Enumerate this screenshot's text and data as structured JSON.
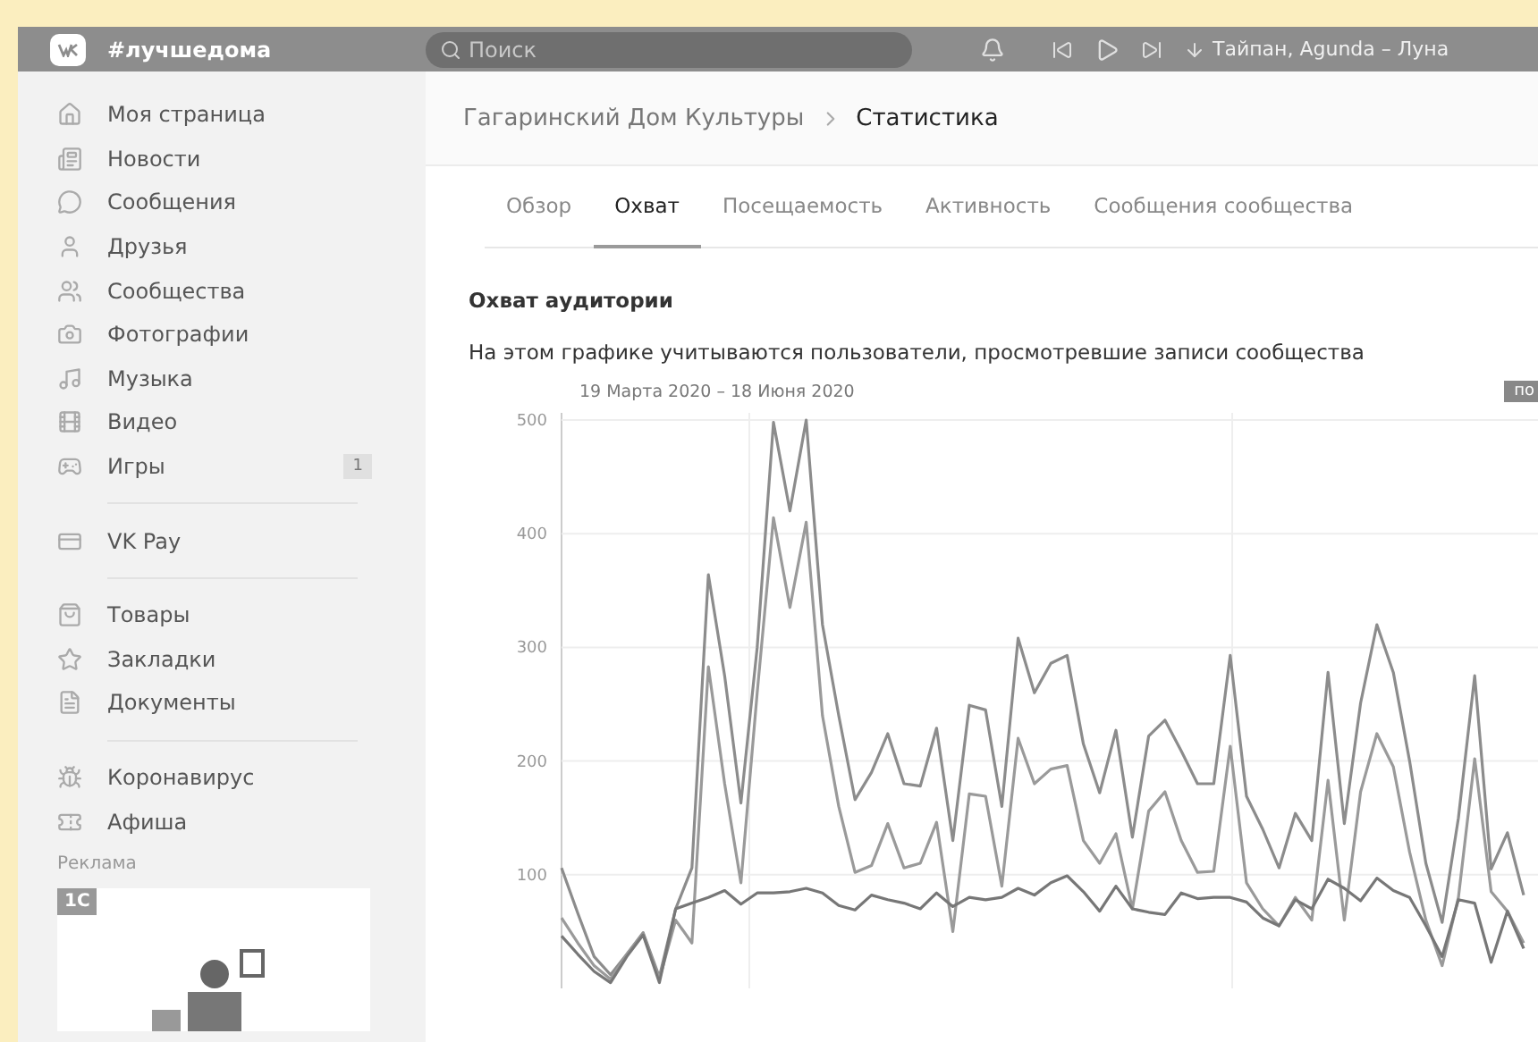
{
  "top_bar": {
    "brand": "#лучшедома",
    "search": {
      "placeholder": "Поиск"
    },
    "player": {
      "track": "Тайпан, Agunda – Луна"
    }
  },
  "sidebar": {
    "groups": [
      [
        {
          "label": "Моя страница"
        },
        {
          "label": "Новости"
        },
        {
          "label": "Сообщения"
        },
        {
          "label": "Друзья"
        },
        {
          "label": "Сообщества"
        },
        {
          "label": "Фотографии"
        },
        {
          "label": "Музыка"
        },
        {
          "label": "Видео"
        },
        {
          "label": "Игры",
          "badge": "1"
        }
      ],
      [
        {
          "label": "VK Pay"
        }
      ],
      [
        {
          "label": "Товары"
        },
        {
          "label": "Закладки"
        },
        {
          "label": "Документы"
        }
      ],
      [
        {
          "label": "Коронавирус"
        },
        {
          "label": "Афиша"
        }
      ]
    ],
    "ad_label": "Реклама",
    "ad_logo": "1С"
  },
  "breadcrumb": {
    "parent": "Гагаринский Дом Культуры",
    "current": "Статистика"
  },
  "tabs": [
    {
      "label": "Обзор",
      "selected": false
    },
    {
      "label": "Охват",
      "selected": true
    },
    {
      "label": "Посещаемость",
      "selected": false
    },
    {
      "label": "Активность",
      "selected": false
    },
    {
      "label": "Сообщения сообщества",
      "selected": false
    }
  ],
  "section": {
    "title": "Охват аудитории",
    "description": "На этом графике учитываются пользователи, просмотревшие записи сообщества",
    "date_range": "19 Марта 2020 – 18 Июня 2020",
    "corner_button": "по",
    "chart_data": {
      "type": "line",
      "grid": true,
      "ylim": [
        0,
        500
      ],
      "yticks": [
        100,
        200,
        300,
        400,
        500
      ],
      "series": [
        {
          "color": "#8c8c8c",
          "values": [
            106,
            66,
            28,
            12,
            30,
            49,
            10,
            70,
            106,
            364,
            275,
            163,
            300,
            498,
            420,
            500,
            320,
            240,
            166,
            190,
            224,
            180,
            178,
            229,
            130,
            249,
            245,
            160,
            308,
            260,
            286,
            293,
            215,
            172,
            227,
            133,
            222,
            236,
            209,
            180,
            180,
            293,
            169,
            140,
            106,
            154,
            130,
            278,
            145,
            251,
            320,
            278,
            200,
            110,
            58,
            150,
            275,
            105,
            137,
            82
          ]
        },
        {
          "color": "#9a9a9a",
          "values": [
            62,
            40,
            20,
            8,
            30,
            48,
            8,
            60,
            40,
            283,
            180,
            93,
            260,
            414,
            335,
            410,
            240,
            160,
            102,
            108,
            145,
            106,
            110,
            146,
            50,
            171,
            169,
            90,
            220,
            180,
            193,
            196,
            130,
            110,
            136,
            70,
            156,
            173,
            130,
            102,
            103,
            213,
            93,
            70,
            55,
            80,
            60,
            183,
            60,
            173,
            224,
            195,
            120,
            60,
            20,
            80,
            202,
            85,
            68,
            40
          ]
        },
        {
          "color": "#777777",
          "values": [
            46,
            30,
            15,
            5,
            28,
            47,
            5,
            70,
            75,
            80,
            86,
            74,
            84,
            84,
            85,
            88,
            84,
            73,
            69,
            82,
            78,
            75,
            70,
            84,
            72,
            80,
            78,
            80,
            88,
            82,
            93,
            99,
            85,
            68,
            90,
            70,
            67,
            65,
            84,
            79,
            80,
            80,
            76,
            62,
            55,
            78,
            70,
            96,
            88,
            77,
            97,
            86,
            80,
            55,
            28,
            78,
            75,
            23,
            68,
            35
          ]
        }
      ]
    }
  }
}
